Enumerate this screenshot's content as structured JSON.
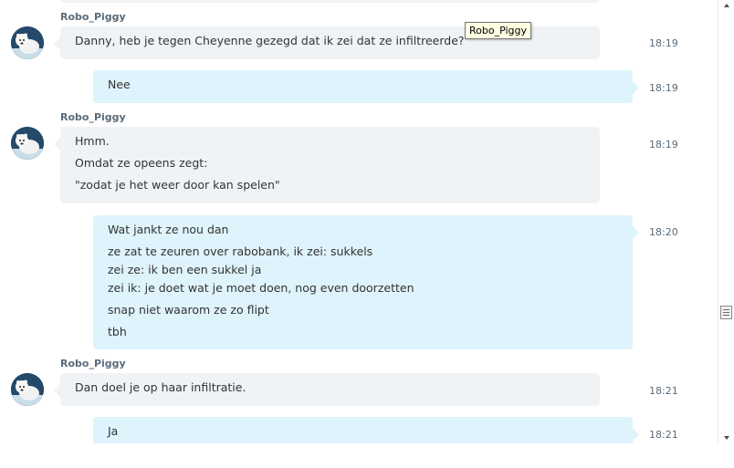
{
  "tooltip": "Robo_Piggy",
  "avatar_icon": "polar-bear-avatar-icon",
  "messages": [
    {
      "sender": "Robo_Piggy",
      "lines": [
        "Danny, heb je tegen Cheyenne gezegd dat ik zei dat ze infiltreerde?"
      ],
      "time": "18:19"
    },
    {
      "lines": [
        "Nee"
      ],
      "time": "18:19"
    },
    {
      "sender": "Robo_Piggy",
      "lines": [
        "Hmm.",
        "Omdat ze opeens zegt:",
        "\"zodat je het weer door kan spelen\""
      ],
      "time": "18:19"
    },
    {
      "lines": [
        "Wat jankt ze nou dan",
        "ze zat te zeuren over rabobank, ik zei: sukkels",
        "zei ze: ik ben een sukkel ja",
        "zei ik: je doet wat je moet doen, nog even doorzetten",
        "snap niet waarom ze zo flipt",
        "tbh"
      ],
      "time": "18:20"
    },
    {
      "sender": "Robo_Piggy",
      "lines": [
        "Dan doel je op haar infiltratie."
      ],
      "time": "18:21"
    },
    {
      "lines": [
        "Ja"
      ],
      "time": "18:21"
    }
  ]
}
